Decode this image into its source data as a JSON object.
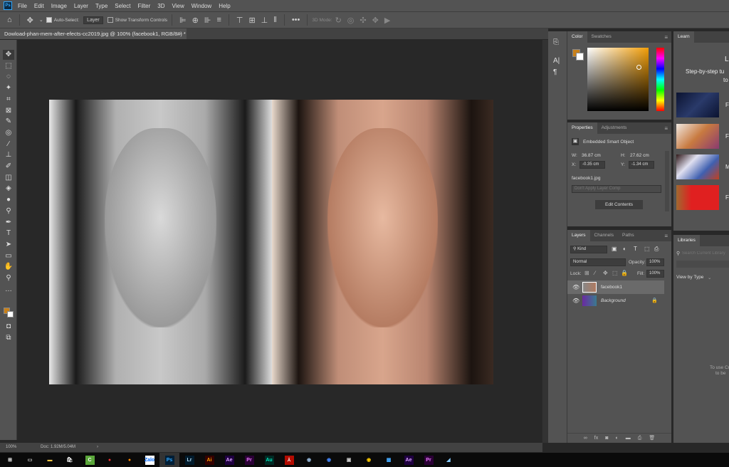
{
  "app": {
    "name": "Adobe Photoshop",
    "logo": "Ps"
  },
  "menu": [
    "File",
    "Edit",
    "Image",
    "Layer",
    "Type",
    "Select",
    "Filter",
    "3D",
    "View",
    "Window",
    "Help"
  ],
  "options": {
    "auto_select_label": "Auto-Select:",
    "auto_select_checked": true,
    "auto_select_target": "Layer",
    "show_transform_label": "Show Transform Controls",
    "show_transform_checked": false,
    "more": "•••",
    "mode_3d_label": "3D Mode:"
  },
  "document": {
    "tab_title": "Dowload-phan-mem-after-efects-cc2019.jpg @ 100% (facebook1, RGB/8#) *",
    "close": "×"
  },
  "tools": [
    "move",
    "marquee",
    "lasso",
    "magic-wand",
    "crop",
    "frame",
    "eyedropper",
    "healing",
    "brush",
    "stamp",
    "history-brush",
    "eraser",
    "paint-bucket",
    "blur",
    "dodge",
    "pen",
    "type",
    "path-select",
    "rectangle",
    "hand",
    "zoom",
    "more"
  ],
  "tool_glyphs": [
    "✥",
    "⬚",
    "◌",
    "✦",
    "⌗",
    "⊠",
    "✎",
    "◎",
    "∕",
    "⊥",
    "✐",
    "◫",
    "◈",
    "●",
    "⚲",
    "✒",
    "T",
    "➤",
    "▭",
    "✋",
    "⚲",
    "…"
  ],
  "colors": {
    "foreground": "#c8801a",
    "background": "#ffffff"
  },
  "color_panel": {
    "tabs": [
      "Color",
      "Swatches"
    ],
    "active": "Color"
  },
  "properties": {
    "tabs": [
      "Properties",
      "Adjustments"
    ],
    "active": "Properties",
    "type": "Embedded Smart Object",
    "w_label": "W:",
    "w": "36.87 cm",
    "h_label": "H:",
    "h": "27.62 cm",
    "x_label": "X:",
    "x": "-0.35 cm",
    "y_label": "Y:",
    "y": "-1.34 cm",
    "file": "facebook1.jpg",
    "layer_comp": "Don't Apply Layer Comp",
    "edit_button": "Edit Contents"
  },
  "layers_panel": {
    "tabs": [
      "Layers",
      "Channels",
      "Paths"
    ],
    "active": "Layers",
    "filter": "Kind",
    "blend_mode": "Normal",
    "opacity_label": "Opacity:",
    "opacity": "100%",
    "lock_label": "Lock:",
    "fill_label": "Fill:",
    "fill": "100%",
    "layers": [
      {
        "name": "facebook1",
        "visible": true,
        "selected": true,
        "locked": false
      },
      {
        "name": "Background",
        "visible": true,
        "selected": false,
        "locked": true
      }
    ]
  },
  "learn": {
    "tab": "Learn",
    "title": "L",
    "subtitle_1": "Step-by-step tu",
    "subtitle_2": "to",
    "items": [
      "F",
      "F",
      "M",
      "F"
    ]
  },
  "libraries": {
    "tab": "Libraries",
    "search_placeholder": "Search Current Library",
    "view_by": "View by Type",
    "message_1": "To use Cr",
    "message_2": "to be"
  },
  "status": {
    "zoom": "100%",
    "doc": "Doc: 1.92M/5.04M"
  },
  "taskbar": [
    {
      "name": "start",
      "label": "⊞",
      "color": "#fff",
      "bg": "transparent"
    },
    {
      "name": "task-view",
      "label": "▭",
      "color": "#ccc",
      "bg": "transparent"
    },
    {
      "name": "file-explorer",
      "label": "▬",
      "color": "#f6c744",
      "bg": "transparent"
    },
    {
      "name": "store",
      "label": "🛍",
      "color": "#fff",
      "bg": "transparent"
    },
    {
      "name": "coc-coc",
      "label": "C",
      "color": "#fff",
      "bg": "#5aa63a"
    },
    {
      "name": "chrome",
      "label": "●",
      "color": "#e33",
      "bg": "transparent"
    },
    {
      "name": "firefox",
      "label": "●",
      "color": "#f80",
      "bg": "transparent"
    },
    {
      "name": "zalo",
      "label": "Zalo",
      "color": "#0068ff",
      "bg": "#fff"
    },
    {
      "name": "photoshop",
      "label": "Ps",
      "color": "#31a8ff",
      "bg": "#001e36"
    },
    {
      "name": "lightroom",
      "label": "Lr",
      "color": "#add5ec",
      "bg": "#001a2b"
    },
    {
      "name": "illustrator",
      "label": "Ai",
      "color": "#ff9a00",
      "bg": "#330000"
    },
    {
      "name": "after-effects",
      "label": "Ae",
      "color": "#d8a0ff",
      "bg": "#1f0040"
    },
    {
      "name": "premiere",
      "label": "Pr",
      "color": "#ea77ff",
      "bg": "#2a0035"
    },
    {
      "name": "audition",
      "label": "Au",
      "color": "#00e4bb",
      "bg": "#002a24"
    },
    {
      "name": "acrobat",
      "label": "⅄",
      "color": "#fff",
      "bg": "#b30b00"
    },
    {
      "name": "app-network",
      "label": "◉",
      "color": "#9bd",
      "bg": "transparent"
    },
    {
      "name": "app-browser",
      "label": "◉",
      "color": "#48f",
      "bg": "transparent"
    },
    {
      "name": "app-media",
      "label": "▣",
      "color": "#ccc",
      "bg": "transparent"
    },
    {
      "name": "davinci",
      "label": "◉",
      "color": "#fc0",
      "bg": "transparent"
    },
    {
      "name": "photos",
      "label": "▩",
      "color": "#4af",
      "bg": "transparent"
    },
    {
      "name": "after-effects-2",
      "label": "Ae",
      "color": "#d8a0ff",
      "bg": "#1f0040"
    },
    {
      "name": "premiere-2",
      "label": "Pr",
      "color": "#ea77ff",
      "bg": "#2a0035"
    },
    {
      "name": "notepad",
      "label": "◢",
      "color": "#8cf",
      "bg": "transparent"
    }
  ]
}
